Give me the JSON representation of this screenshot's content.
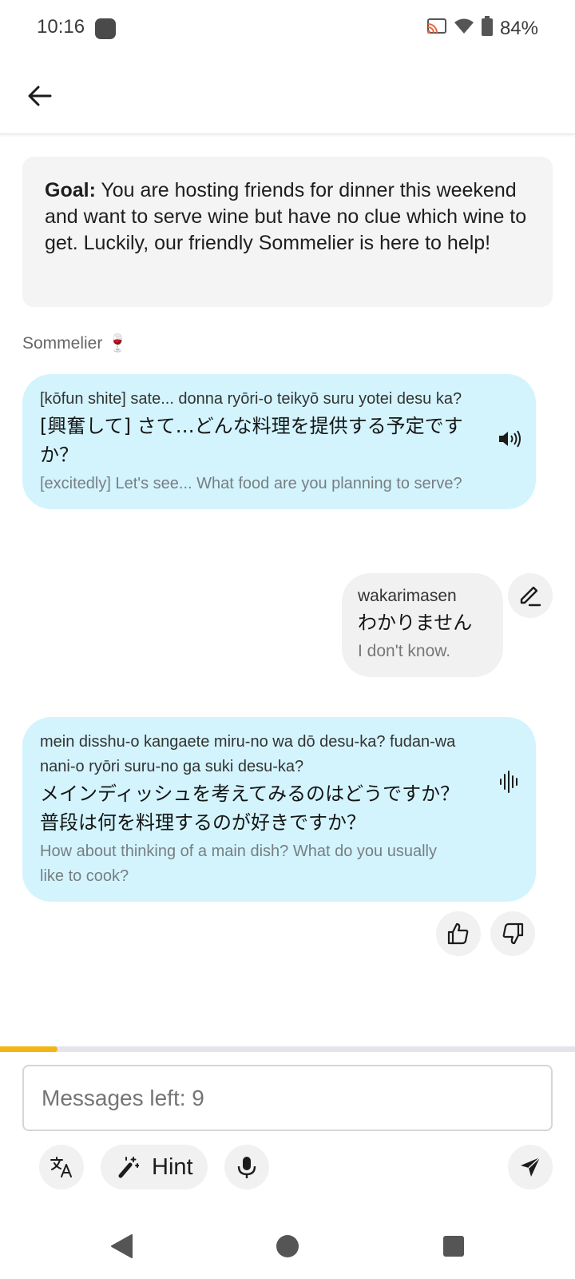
{
  "status_bar": {
    "time": "10:16",
    "battery": "84%",
    "icons": [
      "app-notification-icon",
      "cast-icon",
      "wifi-icon",
      "battery-icon"
    ]
  },
  "header": {
    "back_icon": "arrow-left-icon"
  },
  "goal": {
    "label": "Goal:",
    "text": " You are hosting friends for dinner this weekend and want to serve wine but have no clue which wine to get. Luckily, our friendly Sommelier is here to help!"
  },
  "conversation": {
    "speaker": "Sommelier 🍷",
    "messages": [
      {
        "role": "bot",
        "romanized": "[kōfun shite] sate... donna ryōri-o teikyō suru yotei desu ka?",
        "japanese": "[興奮して] さて…どんな料理を提供する予定ですか？",
        "english": "[excitedly] Let's see... What food are you planning to serve?",
        "icon": "speaker-icon"
      },
      {
        "role": "user",
        "romanized": "wakarimasen",
        "japanese": "わかりません",
        "english": "I don't know.",
        "icon": "edit-pencil-icon"
      },
      {
        "role": "bot",
        "romanized": "mein disshu-o kangaete miru-no wa dō desu-ka? fudan-wa nani-o ryōri suru-no ga suki desu-ka?",
        "japanese": "メインディッシュを考えてみるのはどうですか？普段は何を料理するのが好きですか？",
        "english": "How about thinking of a main dish? What do you usually like to cook?",
        "icon": "audio-waveform-icon"
      }
    ],
    "feedback_icons": [
      "thumbs-up-icon",
      "thumbs-down-icon"
    ]
  },
  "progress": {
    "fraction": 0.1
  },
  "composer": {
    "placeholder": "Messages left: 9",
    "hint_label": "Hint",
    "icons": [
      "translate-icon",
      "magic-wand-icon",
      "microphone-icon",
      "send-icon"
    ]
  },
  "nav_bar": {
    "icons": [
      "nav-back-icon",
      "nav-home-icon",
      "nav-recents-icon"
    ]
  },
  "colors": {
    "bot_bubble": "#d3f4fd",
    "user_bubble": "#f1f1f1",
    "progress": "#f3b512"
  }
}
